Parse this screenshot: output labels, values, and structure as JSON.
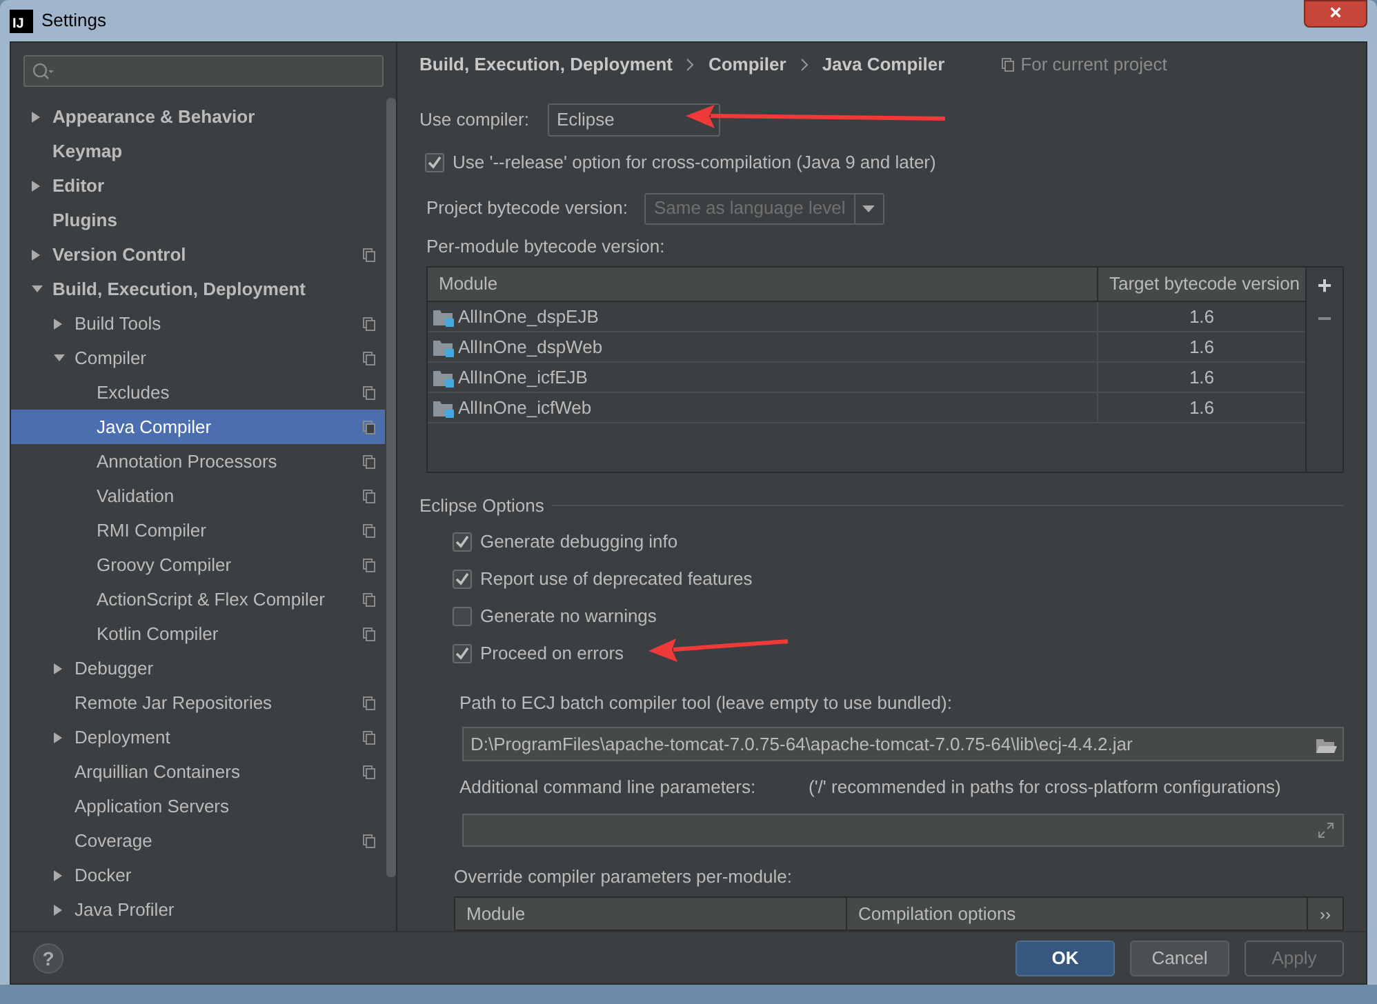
{
  "window": {
    "icon_text": "IJ",
    "title": "Settings",
    "close": "×"
  },
  "sidebar": {
    "items": [
      {
        "label": "Appearance & Behavior",
        "expanded": false,
        "project_level": false,
        "selected": false
      },
      {
        "label": "Keymap",
        "project_level": false,
        "selected": false
      },
      {
        "label": "Editor",
        "expanded": false,
        "project_level": false,
        "selected": false
      },
      {
        "label": "Plugins",
        "project_level": false,
        "selected": false
      },
      {
        "label": "Version Control",
        "expanded": false,
        "project_level": true,
        "selected": false
      },
      {
        "label": "Build, Execution, Deployment",
        "expanded": true,
        "project_level": false,
        "selected": false,
        "children": [
          {
            "label": "Build Tools",
            "expanded": false,
            "project_level": true,
            "selected": false
          },
          {
            "label": "Compiler",
            "expanded": true,
            "project_level": true,
            "selected": false,
            "children": [
              {
                "label": "Excludes",
                "project_level": true,
                "selected": false
              },
              {
                "label": "Java Compiler",
                "project_level": true,
                "selected": true
              },
              {
                "label": "Annotation Processors",
                "project_level": true,
                "selected": false
              },
              {
                "label": "Validation",
                "project_level": true,
                "selected": false
              },
              {
                "label": "RMI Compiler",
                "project_level": true,
                "selected": false
              },
              {
                "label": "Groovy Compiler",
                "project_level": true,
                "selected": false
              },
              {
                "label": "ActionScript & Flex Compiler",
                "project_level": true,
                "selected": false
              },
              {
                "label": "Kotlin Compiler",
                "project_level": true,
                "selected": false
              }
            ]
          },
          {
            "label": "Debugger",
            "expanded": false,
            "project_level": false,
            "selected": false
          },
          {
            "label": "Remote Jar Repositories",
            "project_level": true,
            "selected": false
          },
          {
            "label": "Deployment",
            "expanded": false,
            "project_level": true,
            "selected": false
          },
          {
            "label": "Arquillian Containers",
            "project_level": true,
            "selected": false
          },
          {
            "label": "Application Servers",
            "project_level": false,
            "selected": false
          },
          {
            "label": "Coverage",
            "project_level": true,
            "selected": false
          },
          {
            "label": "Docker",
            "expanded": false,
            "project_level": false,
            "selected": false
          },
          {
            "label": "Java Profiler",
            "expanded": false,
            "project_level": false,
            "selected": false
          }
        ]
      }
    ]
  },
  "breadcrumb": [
    "Build, Execution, Deployment",
    "Compiler",
    "Java Compiler"
  ],
  "scope_note": "For current project",
  "use_compiler": {
    "label": "Use compiler:",
    "value": "Eclipse"
  },
  "release_option": {
    "label": "Use '--release' option for cross-compilation (Java 9 and later)",
    "checked": true
  },
  "project_bytecode": {
    "label": "Project bytecode version:",
    "value": "Same as language level",
    "disabled": true
  },
  "per_module": {
    "label": "Per-module bytecode version:",
    "columns": [
      "Module",
      "Target bytecode version"
    ],
    "rows": [
      {
        "module": "AllInOne_dspEJB",
        "version": "1.6"
      },
      {
        "module": "AllInOne_dspWeb",
        "version": "1.6"
      },
      {
        "module": "AllInOne_icfEJB",
        "version": "1.6"
      },
      {
        "module": "AllInOne_icfWeb",
        "version": "1.6"
      }
    ],
    "add_button": {
      "text": "+",
      "disabled": false
    },
    "remove_button": {
      "text": "−",
      "disabled": true
    }
  },
  "eclipse_options": {
    "title": "Eclipse Options",
    "options": [
      {
        "label": "Generate debugging info",
        "checked": true
      },
      {
        "label": "Report use of deprecated features",
        "checked": true
      },
      {
        "label": "Generate no warnings",
        "checked": false
      },
      {
        "label": "Proceed on errors",
        "checked": true
      }
    ],
    "path": {
      "label": "Path to ECJ batch compiler tool (leave empty to use bundled):",
      "value": "D:\\ProgramFiles\\apache-tomcat-7.0.75-64\\apache-tomcat-7.0.75-64\\lib\\ecj-4.4.2.jar"
    },
    "additional": {
      "label": "Additional command line parameters:",
      "hint": "('/' recommended in paths for cross-platform configurations)"
    },
    "override": {
      "label": "Override compiler parameters per-module:",
      "columns": [
        "Module",
        "Compilation options"
      ],
      "more": "››"
    }
  },
  "help": "?",
  "buttons": [
    {
      "label": "OK",
      "kind": "primary"
    },
    {
      "label": "Cancel",
      "kind": "normal"
    },
    {
      "label": "Apply",
      "kind": "disabled"
    }
  ]
}
